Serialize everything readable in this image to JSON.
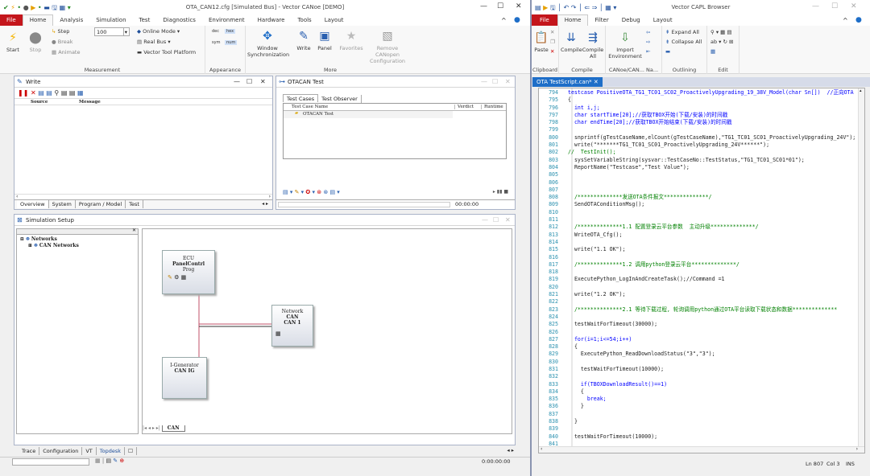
{
  "canoe": {
    "title": "OTA_CAN12.cfg [Simulated Bus] - Vector CANoe [DEMO]",
    "menu": [
      "File",
      "Home",
      "Analysis",
      "Simulation",
      "Test",
      "Diagnostics",
      "Environment",
      "Hardware",
      "Tools",
      "Layout"
    ],
    "measurement": {
      "start": "Start",
      "stop": "Stop",
      "step": "Step",
      "break": "Break",
      "animate": "Animate",
      "speed": "100",
      "online_mode": "Online Mode",
      "real_bus": "Real Bus",
      "vector_tool_platform": "Vector Tool Platform",
      "label": "Measurement"
    },
    "appearance": {
      "label": "Appearance",
      "dec": "dec",
      "hex": "hex",
      "sym": "sym",
      "num": "num"
    },
    "more": {
      "window_sync": "Window Synchronization",
      "write": "Write",
      "panel": "Panel",
      "favorites": "Favorites",
      "remove_canopen": "Remove CANopen Configuration",
      "label": "More"
    },
    "write_window": {
      "title": "Write",
      "col_source": "Source",
      "col_message": "Message",
      "tabs": [
        "Overview",
        "System",
        "Program / Model",
        "Test"
      ]
    },
    "otacan_window": {
      "title": "OTACAN Test",
      "tabs": [
        "Test Cases",
        "Test Observer"
      ],
      "col_name": "Test Case Name",
      "col_verdict": "Verdict",
      "col_runtime": "Runtime",
      "row": "OTACAN Test",
      "time": "00:00:00"
    },
    "sim_setup": {
      "title": "Simulation Setup",
      "tree_root": "Networks",
      "tree_child": "CAN Networks",
      "ecu": {
        "l1": "ECU",
        "l2": "PanelContrl",
        "l3": "Prog"
      },
      "network": {
        "l1": "Network",
        "l2": "CAN",
        "l3": "CAN 1"
      },
      "igen": {
        "l1": "I-Generator",
        "l2": "CAN IG"
      },
      "tab": "CAN"
    },
    "bottom_tabs": [
      "Trace",
      "Configuration",
      "VT",
      "Topdesk"
    ],
    "status_time": "0:00:00:00"
  },
  "capl": {
    "title": "Vector CAPL Browser",
    "menu": [
      "File",
      "Home",
      "Filter",
      "Debug",
      "Layout"
    ],
    "clipboard": {
      "paste": "Paste",
      "label": "Clipboard"
    },
    "compile": {
      "compile": "Compile",
      "compile_all": "Compile All",
      "label": "Compile"
    },
    "canoe_na": {
      "import": "Import Environment",
      "label": "CANoe/CAN... Na..."
    },
    "outlining": {
      "expand": "Expand All",
      "collapse": "Collapse All",
      "label": "Outlining"
    },
    "edit": {
      "label": "Edit"
    },
    "file_tab": "OTA TestScript.can*",
    "status": {
      "ln": "Ln 807",
      "col": "Col 3",
      "ins": "INS"
    },
    "code": [
      {
        "n": "794",
        "t": "testcase PositiveOTA_TG1_TC01_SC02_ProactivelyUpgrading_19_38V_Model(char Sn[])  //正向OTA"
      },
      {
        "n": "795",
        "t": "{"
      },
      {
        "n": "796",
        "t": "  int i,j;"
      },
      {
        "n": "797",
        "t": "  char startTime[20];//获取TBOX开始(下载/安装)的时间戳"
      },
      {
        "n": "798",
        "t": "  char endTime[20];//获取TBOX开始结束(下载/安装)的时间戳"
      },
      {
        "n": "799",
        "t": ""
      },
      {
        "n": "800",
        "t": "  snprintf(gTestCaseName,elCount(gTestCaseName),\"TG1_TC01_SC01_ProactivelyUpgrading_24V\");"
      },
      {
        "n": "801",
        "t": "  write(\"*******TG1_TC01_SC01_ProactivelyUpgrading_24V******\");"
      },
      {
        "n": "802",
        "t": "//  TestInit();"
      },
      {
        "n": "803",
        "t": "  sysSetVariableString(sysvar::TestCaseNo::TestStatus,\"TG1_TC01_SC01*01\");"
      },
      {
        "n": "804",
        "t": "  ReportName(\"Testcase\",\"Test Value\");"
      },
      {
        "n": "805",
        "t": ""
      },
      {
        "n": "806",
        "t": ""
      },
      {
        "n": "807",
        "t": ""
      },
      {
        "n": "808",
        "t": "  /**************发送OTA条件报文**************/"
      },
      {
        "n": "809",
        "t": "  SendOTAConditionMsg();"
      },
      {
        "n": "810",
        "t": ""
      },
      {
        "n": "811",
        "t": ""
      },
      {
        "n": "812",
        "t": "  /**************1.1 配置登录云平台参数  主动升级**************/"
      },
      {
        "n": "813",
        "t": "  WriteOTA_Cfg();"
      },
      {
        "n": "814",
        "t": ""
      },
      {
        "n": "815",
        "t": "  write(\"1.1 OK\");"
      },
      {
        "n": "816",
        "t": ""
      },
      {
        "n": "817",
        "t": "  /**************1.2 调用python登录云平台**************/"
      },
      {
        "n": "818",
        "t": ""
      },
      {
        "n": "819",
        "t": "  ExecutePython_LogInAndCreateTask();//Command =1"
      },
      {
        "n": "820",
        "t": ""
      },
      {
        "n": "821",
        "t": "  write(\"1.2 OK\");"
      },
      {
        "n": "822",
        "t": ""
      },
      {
        "n": "823",
        "t": "  /**************2.1 等待下载过程, 轮询调用python通过OTA平台读取下载状态和数据**************"
      },
      {
        "n": "824",
        "t": ""
      },
      {
        "n": "825",
        "t": "  testWaitForTimeout(30000);"
      },
      {
        "n": "826",
        "t": ""
      },
      {
        "n": "827",
        "t": "  for(i=1;i<=54;i++)"
      },
      {
        "n": "828",
        "t": "  {"
      },
      {
        "n": "829",
        "t": "    ExecutePython_ReadDownloadStatus(\"3\",\"3\");"
      },
      {
        "n": "830",
        "t": ""
      },
      {
        "n": "831",
        "t": "    testWaitForTimeout(10000);"
      },
      {
        "n": "832",
        "t": ""
      },
      {
        "n": "833",
        "t": "    if(TBOXDownloadResult()==1)"
      },
      {
        "n": "834",
        "t": "    {"
      },
      {
        "n": "835",
        "t": "      break;"
      },
      {
        "n": "836",
        "t": "    }"
      },
      {
        "n": "837",
        "t": ""
      },
      {
        "n": "838",
        "t": "  }"
      },
      {
        "n": "839",
        "t": ""
      },
      {
        "n": "840",
        "t": "  testWaitForTimeout(10000);"
      },
      {
        "n": "841",
        "t": ""
      }
    ]
  }
}
